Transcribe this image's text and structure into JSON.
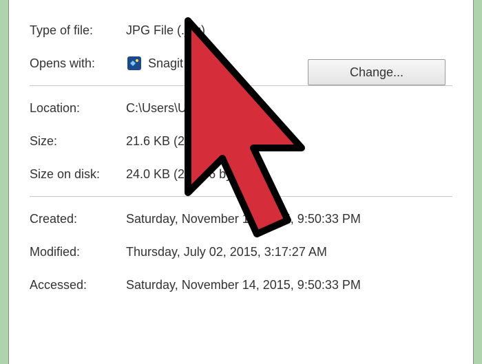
{
  "properties": {
    "type_of_file": {
      "label": "Type of file:",
      "value": "JPG File (.jpg)"
    },
    "opens_with": {
      "label": "Opens with:",
      "value": "Snagit Editor"
    },
    "change_button": "Change...",
    "location": {
      "label": "Location:",
      "value": "C:\\Users\\User"
    },
    "size": {
      "label": "Size:",
      "value": "21.6 KB (22,118 bytes)"
    },
    "size_on_disk": {
      "label": "Size on disk:",
      "value": "24.0 KB (24,576 bytes)"
    },
    "created": {
      "label": "Created:",
      "value": "Saturday, November 14, 2015, 9:50:33 PM"
    },
    "modified": {
      "label": "Modified:",
      "value": "Thursday, July 02, 2015, 3:17:27 AM"
    },
    "accessed": {
      "label": "Accessed:",
      "value": "Saturday, November 14, 2015, 9:50:33 PM"
    }
  }
}
